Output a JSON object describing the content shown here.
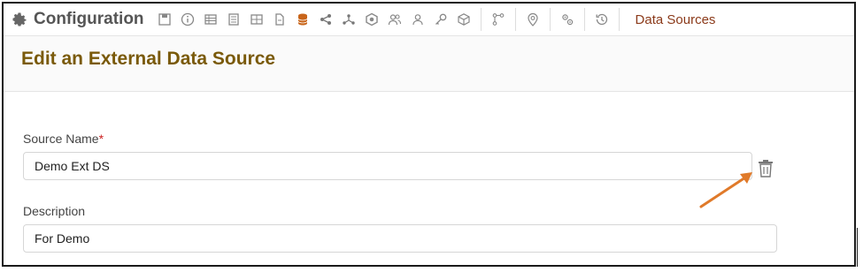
{
  "toolbar": {
    "title": "Configuration",
    "icons": [
      "save-icon",
      "info-icon",
      "table-icon",
      "document-lines-icon",
      "grid-icon",
      "file-icon",
      "database-icon",
      "share-icon",
      "network-icon",
      "hex-nut-icon",
      "users-icon",
      "user-icon",
      "key-icon",
      "cube-icon",
      "node-link-icon",
      "map-pin-icon",
      "cogs-icon",
      "history-icon"
    ],
    "link_label": "Data Sources"
  },
  "page": {
    "title": "Edit an External Data Source"
  },
  "form": {
    "source_name_label": "Source Name",
    "required_mark": "*",
    "source_name_value": "Demo Ext DS",
    "description_label": "Description",
    "description_value": "For Demo"
  },
  "colors": {
    "accent": "#c8651a",
    "title": "#7a5a0a",
    "link": "#8b3a1a",
    "required": "#cc1f1f"
  }
}
